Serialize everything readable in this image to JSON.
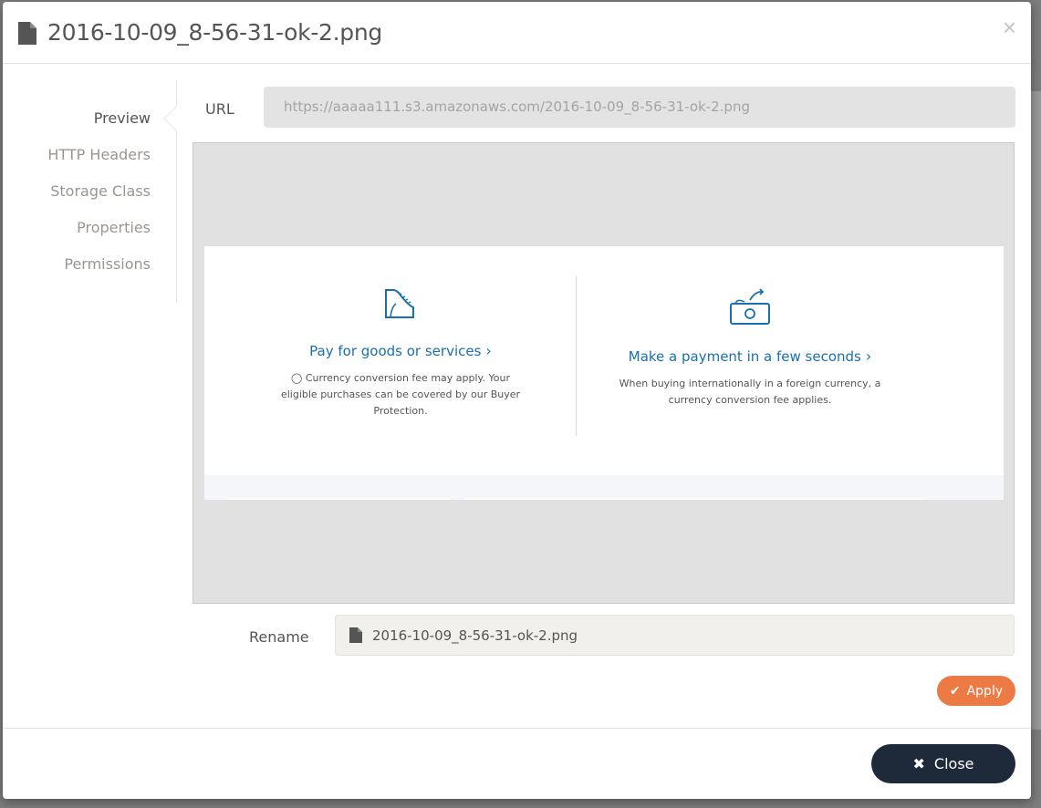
{
  "modal": {
    "title": "2016-10-09_8-56-31-ok-2.png",
    "close_symbol": "×"
  },
  "sidebar": {
    "items": [
      {
        "label": "Preview",
        "active": true
      },
      {
        "label": "HTTP Headers",
        "active": false
      },
      {
        "label": "Storage Class",
        "active": false
      },
      {
        "label": "Properties",
        "active": false
      },
      {
        "label": "Permissions",
        "active": false
      }
    ]
  },
  "url": {
    "label": "URL",
    "value": "https://aaaaa111.s3.amazonaws.com/2016-10-09_8-56-31-ok-2.png"
  },
  "preview": {
    "left": {
      "title": "Pay for goods or services",
      "description": "Currency conversion fee may apply. Your eligible purchases can be covered by our Buyer Protection.",
      "icon": "receipt-icon"
    },
    "right": {
      "title": "Make a payment in a few seconds",
      "description": "When buying internationally in a foreign currency, a currency conversion fee applies.",
      "icon": "money-send-icon"
    },
    "chevron": "›",
    "link_color": "#1a6fae"
  },
  "rename": {
    "label": "Rename",
    "value": "2016-10-09_8-56-31-ok-2.png"
  },
  "actions": {
    "apply_label": "Apply",
    "close_label": "Close"
  },
  "colors": {
    "apply": "#ec7a45",
    "close": "#1e2a3a"
  }
}
